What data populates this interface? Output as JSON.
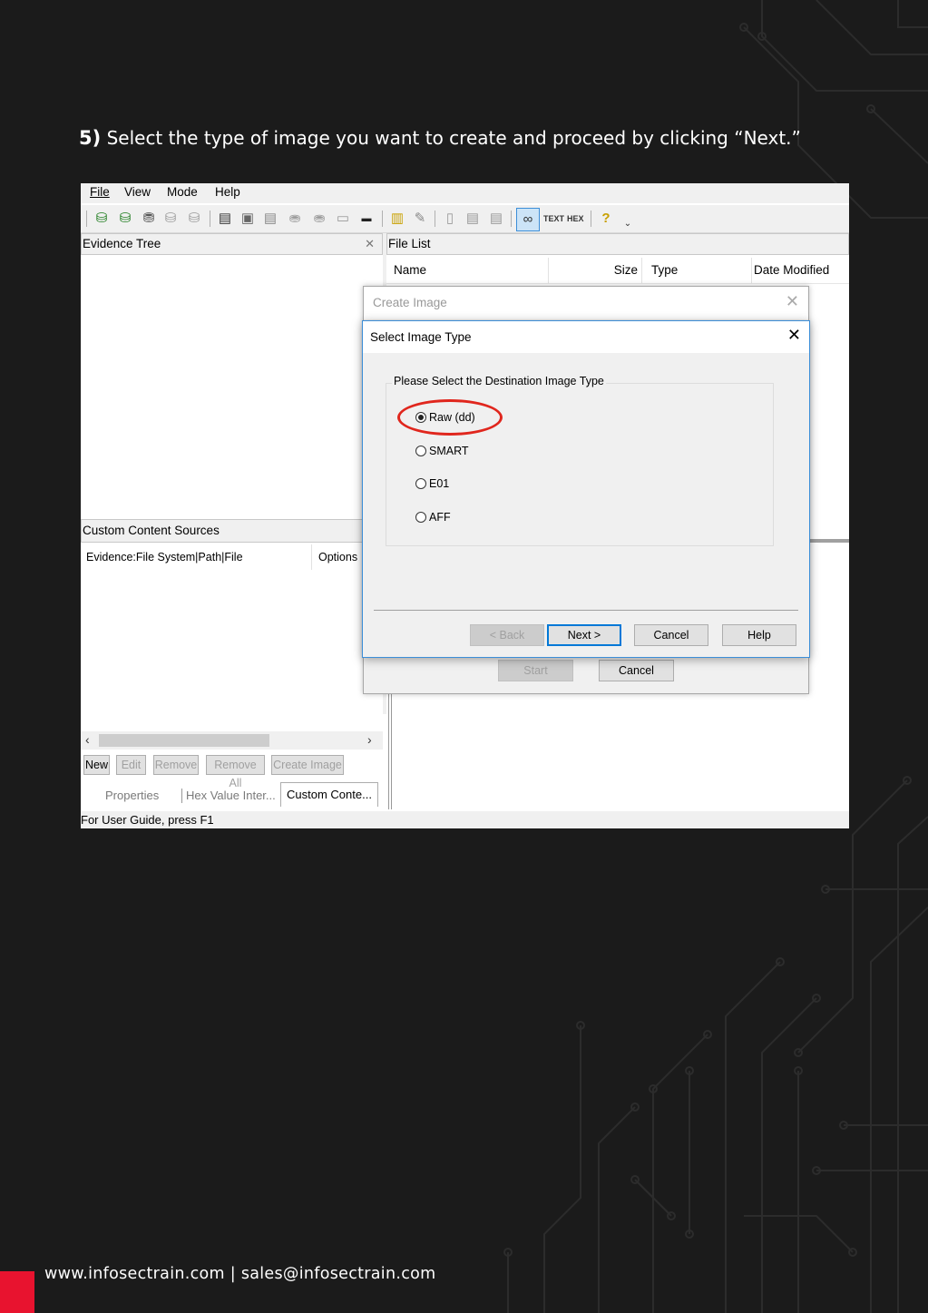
{
  "instruction": {
    "number": "5)",
    "text": "Select the type of image you want to create and proceed by clicking “Next.”"
  },
  "app": {
    "menu": [
      "File",
      "View",
      "Mode",
      "Help"
    ],
    "evidence_tree_title": "Evidence Tree",
    "file_list_title": "File List",
    "file_list_columns": [
      "Name",
      "Size",
      "Type",
      "Date Modified"
    ],
    "custom_content_title": "Custom Content Sources",
    "custom_content_columns": [
      "Evidence:File System|Path|File",
      "Options"
    ],
    "buttons": [
      "New",
      "Edit",
      "Remove",
      "Remove All",
      "Create Image"
    ],
    "tabs": [
      "Properties",
      "Hex Value Inter...",
      "Custom Conte..."
    ],
    "status": "For User Guide, press F1"
  },
  "create_image_dialog": {
    "title": "Create Image",
    "start_label": "Start",
    "cancel_label": "Cancel"
  },
  "select_type_dialog": {
    "title": "Select Image Type",
    "group_label": "Please Select the Destination Image Type",
    "options": [
      "Raw (dd)",
      "SMART",
      "E01",
      "AFF"
    ],
    "selected": "Raw (dd)",
    "back_label": "< Back",
    "next_label": "Next >",
    "cancel_label": "Cancel",
    "help_label": "Help"
  },
  "footer": {
    "text": "www.infosectrain.com | sales@infosectrain.com"
  },
  "colors": {
    "page_bg": "#1b1b1b",
    "highlight": "#e0261d",
    "brand_red": "#e8132f",
    "dialog_border": "#3c8ed8"
  }
}
